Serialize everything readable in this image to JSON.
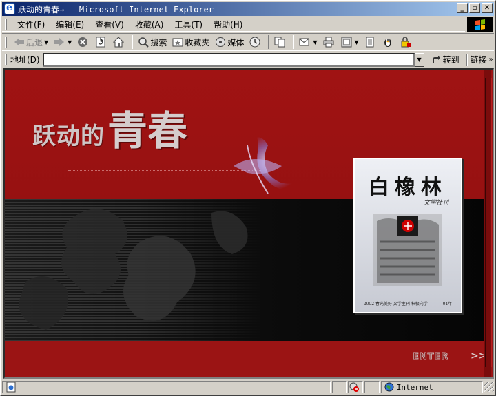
{
  "window": {
    "title": "跃动的青春→ - Microsoft Internet Explorer",
    "controls": [
      "_",
      "▫",
      "✕"
    ]
  },
  "menu": {
    "items": [
      "文件(F)",
      "编辑(E)",
      "查看(V)",
      "收藏(A)",
      "工具(T)",
      "帮助(H)"
    ]
  },
  "toolbar": {
    "back_label": "后退",
    "search_label": "搜索",
    "favorites_label": "收藏夹",
    "media_label": "媒体"
  },
  "address": {
    "label": "地址(D)",
    "value": "",
    "go_label": "转到",
    "links_label": "链接"
  },
  "page": {
    "headline_small": "跃动的",
    "headline_big": "青春",
    "book_title": "白橡林",
    "book_subtitle": "文学社刊",
    "book_footer": "2002 春光美好  文学主刊  积极向学  ———  04年",
    "enter_label": "ENTER",
    "enter_arrow": ">>"
  },
  "status": {
    "zone_label": "Internet"
  },
  "colors": {
    "titlebar_start": "#0a246a",
    "titlebar_end": "#a6caf0",
    "page_red": "#9b1414",
    "chrome": "#d4d0c8"
  }
}
